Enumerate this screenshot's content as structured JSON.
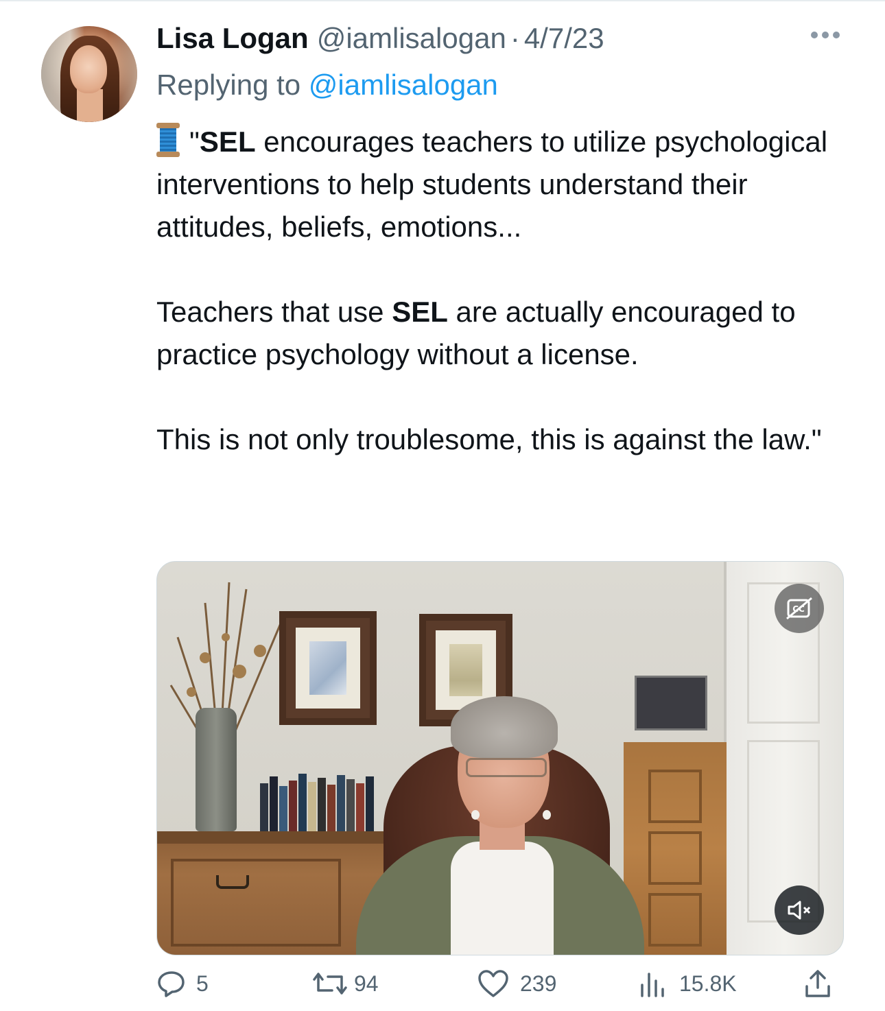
{
  "tweet": {
    "author_name": "Lisa Logan",
    "author_handle": "@iamlisalogan",
    "separator": "·",
    "date": "4/7/23",
    "replying_prefix": "Replying to ",
    "replying_handle": "@iamlisalogan",
    "text": {
      "p1_quote_open": "\"",
      "p1_bold": "SEL",
      "p1_rest": " encourages teachers to utilize psychological interventions to help students understand their attitudes, beliefs, emotions...",
      "p2_start": "Teachers that use ",
      "p2_bold": "SEL",
      "p2_rest": " are actually encouraged to practice psychology without a license.",
      "p3": "This is not only troublesome, this is against the law.\""
    },
    "emoji_icon": "spool-of-thread-icon"
  },
  "media": {
    "type": "video",
    "cc_icon": "captions-off-icon",
    "mute_icon": "speaker-muted-icon"
  },
  "actions": {
    "replies": "5",
    "retweets": "94",
    "likes": "239",
    "views": "15.8K",
    "icons": [
      "reply-icon",
      "retweet-icon",
      "like-icon",
      "views-icon",
      "share-icon"
    ]
  },
  "colors": {
    "text": "#0f1419",
    "secondary": "#536471",
    "link": "#1d9bf0"
  }
}
